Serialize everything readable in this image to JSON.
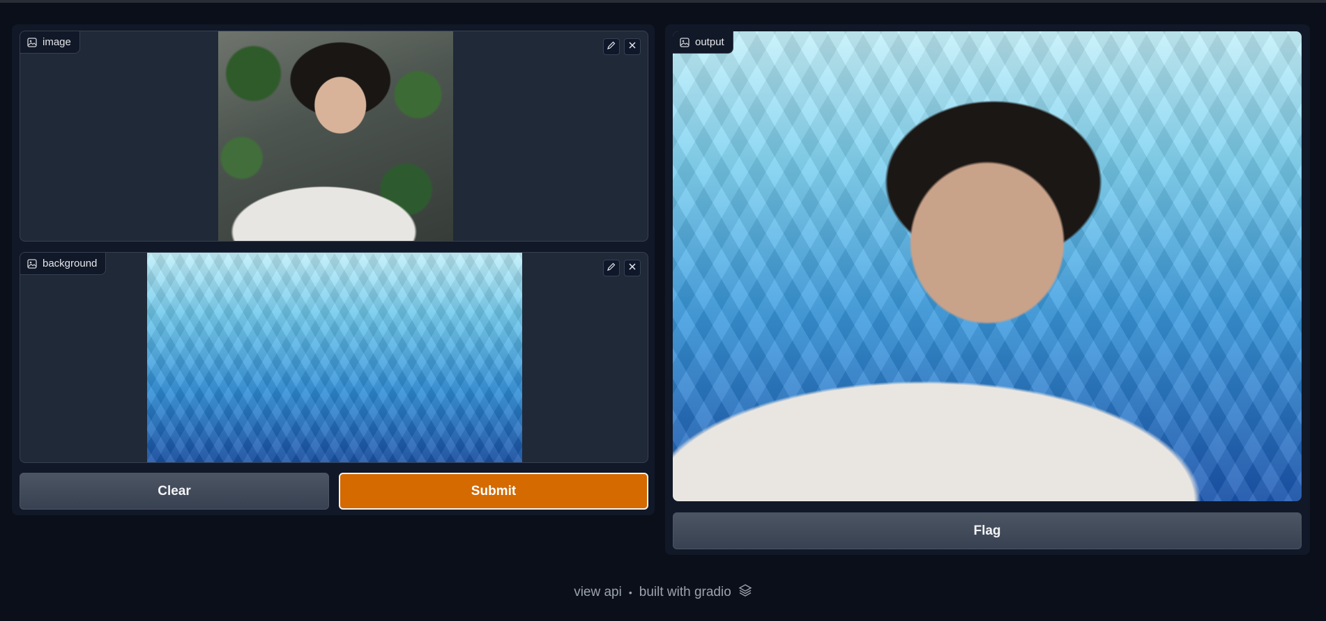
{
  "inputs": {
    "image": {
      "label": "image"
    },
    "background": {
      "label": "background"
    }
  },
  "actions": {
    "clear_label": "Clear",
    "submit_label": "Submit"
  },
  "output": {
    "label": "output",
    "flag_label": "Flag"
  },
  "footer": {
    "view_api": "view api",
    "separator": "•",
    "built_with": "built with gradio"
  },
  "colors": {
    "page_bg": "#0b0f19",
    "panel_bg": "#111827",
    "primary": "#d46a00",
    "secondary": "#4b5563"
  },
  "icons": [
    "image-icon",
    "edit-icon",
    "close-icon",
    "gradio-logo-icon"
  ]
}
